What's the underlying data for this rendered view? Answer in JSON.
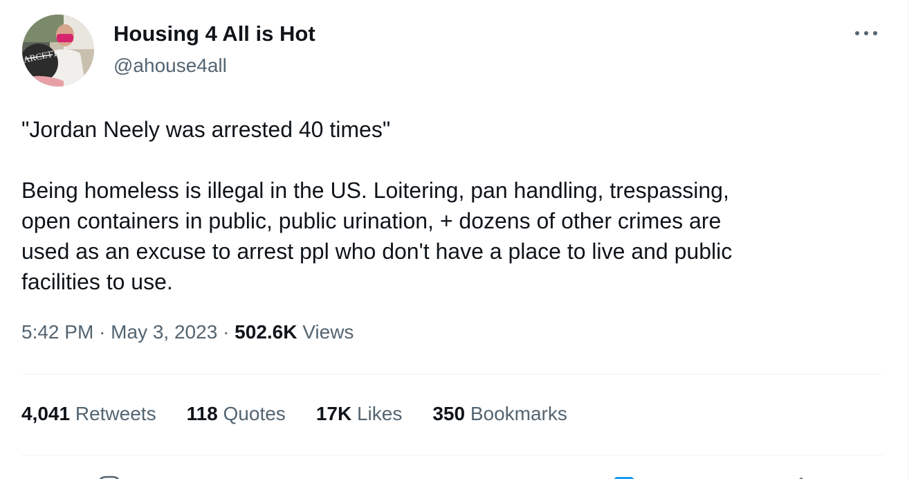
{
  "author": {
    "name": "Housing 4 All is Hot",
    "handle": "@ahouse4all",
    "avatar_sign_text": "ARCETTI"
  },
  "more_icon": "more-horizontal-icon",
  "tweet": {
    "paragraph_1": "\"Jordan Neely was arrested 40 times\"",
    "paragraph_2": "Being homeless is illegal in the US. Loitering, pan handling, trespassing,\nopen containers in public, public urination, + dozens of other crimes are\nused as an excuse to arrest ppl who don't have a place to live and public\nfacilities to use."
  },
  "meta": {
    "time": "5:42 PM",
    "separator": "·",
    "date": "May 3, 2023",
    "views_count": "502.6K",
    "views_label": "Views"
  },
  "stats": [
    {
      "count": "4,041",
      "label": "Retweets"
    },
    {
      "count": "118",
      "label": "Quotes"
    },
    {
      "count": "17K",
      "label": "Likes"
    },
    {
      "count": "350",
      "label": "Bookmarks"
    }
  ],
  "actions": [
    {
      "icon": "reply-icon"
    },
    {
      "icon": "share-icon"
    },
    {
      "icon": "upload-icon"
    }
  ],
  "colors": {
    "text_primary": "#0f1419",
    "text_secondary": "#536471",
    "divider": "#eff3f4",
    "accent": "#1d9bf0"
  }
}
